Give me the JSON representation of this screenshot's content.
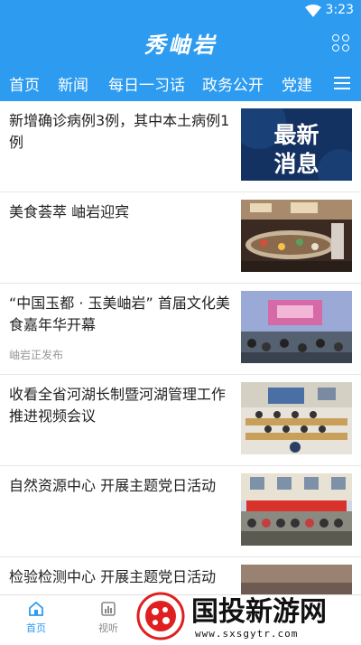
{
  "status": {
    "time": "3:23"
  },
  "app": {
    "title": "秀岫岩"
  },
  "tabs": [
    {
      "label": "首页"
    },
    {
      "label": "新闻"
    },
    {
      "label": "每日一习话"
    },
    {
      "label": "政务公开"
    },
    {
      "label": "党建"
    }
  ],
  "news": [
    {
      "title": "新增确诊病例3例，其中本土病例1例",
      "source": "",
      "thumb_text": "最新消息"
    },
    {
      "title": "美食荟萃  岫岩迎宾",
      "source": ""
    },
    {
      "title": "“中国玉都 · 玉美岫岩” 首届文化美食嘉年华开幕",
      "source": "岫岩正发布"
    },
    {
      "title": "收看全省河湖长制暨河湖管理工作推进视频会议",
      "source": ""
    },
    {
      "title": "自然资源中心  开展主题党日活动",
      "source": ""
    },
    {
      "title": "检验检测中心  开展主题党日活动",
      "source": ""
    }
  ],
  "tabbar": [
    {
      "label": "首页"
    },
    {
      "label": "视听"
    }
  ],
  "watermark": {
    "text": "国投新游网",
    "url": "www.sxsgytr.com"
  },
  "colors": {
    "primary": "#2c9bf0"
  }
}
